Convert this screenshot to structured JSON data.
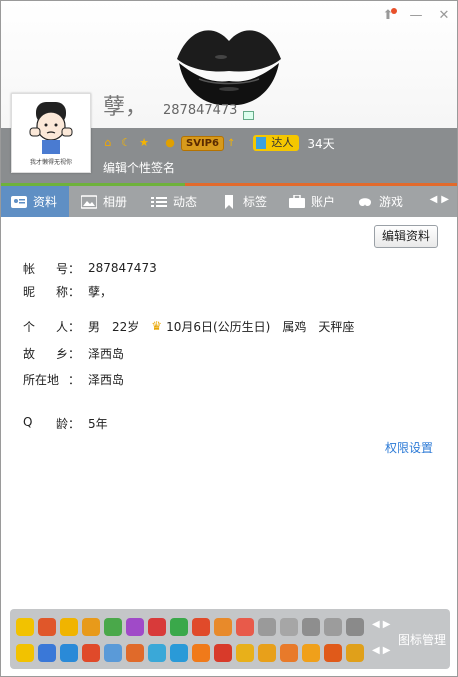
{
  "window": {
    "controls": {
      "skin": "skin-icon",
      "minimize": "—",
      "close": "✕"
    }
  },
  "profile": {
    "nickname": "孽，",
    "qq_number": "287847473",
    "avatar_caption": "我才懒得无视你",
    "svip_label": "SVIP6",
    "talent_label": "达人",
    "talent_days": "34天",
    "signature": "编辑个性签名"
  },
  "tabs": [
    {
      "label": "资料",
      "icon": "profile-card-icon"
    },
    {
      "label": "相册",
      "icon": "photo-icon"
    },
    {
      "label": "动态",
      "icon": "feed-list-icon"
    },
    {
      "label": "标签",
      "icon": "bookmark-icon"
    },
    {
      "label": "账户",
      "icon": "wallet-icon"
    },
    {
      "label": "游戏",
      "icon": "game-icon"
    }
  ],
  "toolbar": {
    "edit_label": "编辑资料"
  },
  "info": {
    "account_label": [
      "帐",
      "号："
    ],
    "account_value": "287847473",
    "nick_label": [
      "昵",
      "称："
    ],
    "nick_value": "孽，",
    "personal_label": [
      "个",
      "人："
    ],
    "gender": "男",
    "age": "22岁",
    "birthday": "10月6日(公历生日)",
    "zodiac": "属鸡",
    "constellation": "天秤座",
    "hometown_label": [
      "故",
      "乡："
    ],
    "hometown_value": "泽西岛",
    "location_label": [
      "所在地",
      "："
    ],
    "location_value": "泽西岛",
    "qage_label": [
      "Q",
      "龄："
    ],
    "qage_value": "5年"
  },
  "links": {
    "permissions": "权限设置"
  },
  "icon_panel": {
    "manage_label": "图标管理"
  },
  "colors": {
    "tab_active": "#5f8fc4",
    "tab_bar_accent": "#e26a2c",
    "tab_green": "#6eb23b",
    "link": "#2c7ad6",
    "header_strip": "#8a8d8f"
  }
}
